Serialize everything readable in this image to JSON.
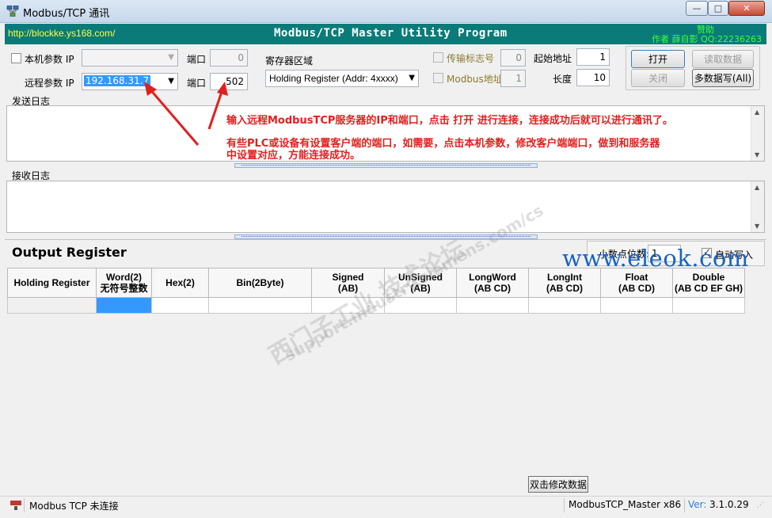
{
  "window": {
    "title": "Modbus/TCP 通讯",
    "min_glyph": "—",
    "max_glyph": "□",
    "close_glyph": "✕"
  },
  "banner": {
    "url": "http://blockke.ys168.com/",
    "program_title": "Modbus/TCP Master Utility Program",
    "sponsor": "赞助",
    "author": "作者  薛自影  QQ:22236263",
    "color": "#0b7b79"
  },
  "connection": {
    "local_checkbox_label": "本机参数 IP",
    "local_ip": "",
    "local_port_label": "端口",
    "local_port": "0",
    "remote_label": "远程参数 IP",
    "remote_ip": "192.168.31.7",
    "remote_port_label": "端口",
    "remote_port": "502"
  },
  "register": {
    "area_label": "寄存器区域",
    "area_value": "Holding Register (Addr: 4xxxx)",
    "transfer_flag_label": "传输标志号",
    "transfer_flag_value": "0",
    "modbus_addr_label": "Modbus地址",
    "modbus_addr_value": "1",
    "start_addr_label": "起始地址",
    "start_addr_value": "1",
    "length_label": "长度",
    "length_value": "10"
  },
  "buttons": {
    "open": "打开",
    "read": "读取数据",
    "close": "关闭",
    "multi_write": "多数据写(All)",
    "edit_data": "双击修改数据"
  },
  "send_log": {
    "label": "发送日志",
    "annotation_line1": "输入远程ModbusTCP服务器的IP和端口，点击 打开 进行连接，连接成功后就可以进行通讯了。",
    "annotation_line2": "有些PLC或设备有设置客户端的端口，如需要，点击本机参数，修改客户端端口，做到和服务器",
    "annotation_line3": "中设置对应，方能连接成功。"
  },
  "recv_log": {
    "label": "接收日志"
  },
  "output": {
    "title": "Output Register",
    "decimal_label": "小数点位数:",
    "decimal_value": "1",
    "auto_write_label": "自动写入",
    "auto_write_checked": true,
    "columns": [
      {
        "line1": "Holding Register",
        "line2": ""
      },
      {
        "line1": "Word(2)",
        "line2": "无符号整数"
      },
      {
        "line1": "Hex(2)",
        "line2": ""
      },
      {
        "line1": "Bin(2Byte)",
        "line2": ""
      },
      {
        "line1": "Signed",
        "line2": "(AB)"
      },
      {
        "line1": "UnSigned",
        "line2": "(AB)"
      },
      {
        "line1": "LongWord",
        "line2": "(AB CD)"
      },
      {
        "line1": "LongInt",
        "line2": "(AB CD)"
      },
      {
        "line1": "Float",
        "line2": "(AB CD)"
      },
      {
        "line1": "Double",
        "line2": "(AB CD EF GH)"
      }
    ]
  },
  "watermarks": {
    "cn_text": "西门子工业 技术论坛",
    "url_text": "support.industry.siemens.com/cs",
    "eleok": "www.eleok.com"
  },
  "statusbar": {
    "connection_status": "Modbus TCP 未连接",
    "app_name": "ModbusTCP_Master x86",
    "version_label": "Ver:",
    "version_value": "3.1.0.29"
  }
}
